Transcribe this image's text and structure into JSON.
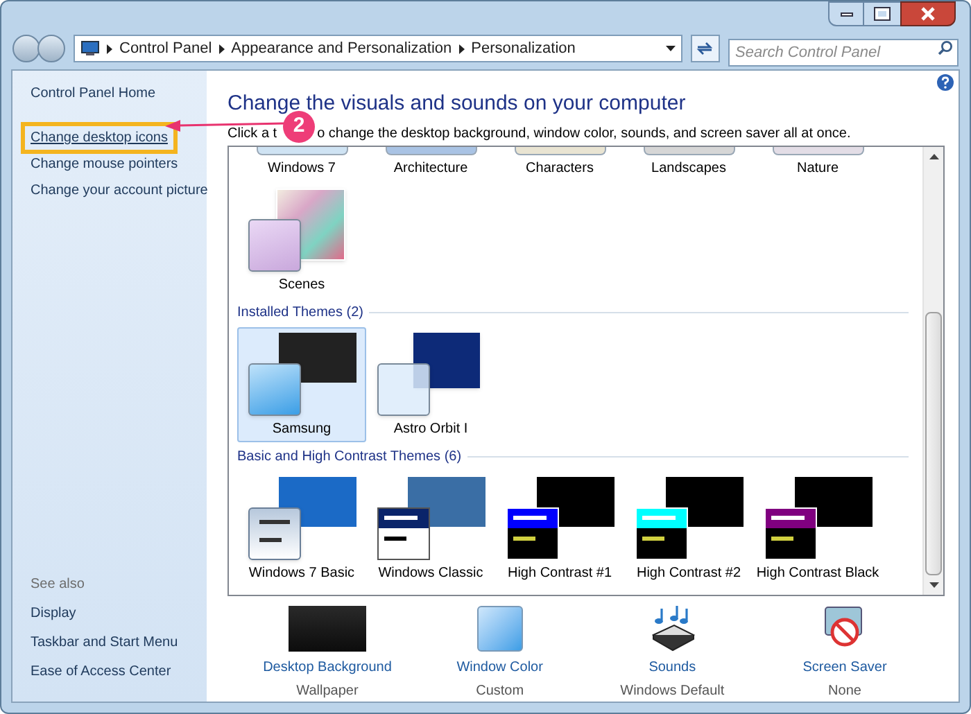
{
  "address_bar": {
    "breadcrumbs": [
      "Control Panel",
      "Appearance and Personalization",
      "Personalization"
    ]
  },
  "search": {
    "placeholder": "Search Control Panel"
  },
  "sidebar": {
    "home": "Control Panel Home",
    "tasks": [
      {
        "label": "Change desktop icons",
        "highlighted": true
      },
      {
        "label": "Change mouse pointers",
        "highlighted": false
      },
      {
        "label": "Change your account picture",
        "highlighted": false
      }
    ],
    "see_also_title": "See also",
    "see_also": [
      "Display",
      "Taskbar and Start Menu",
      "Ease of Access Center"
    ]
  },
  "annotation": {
    "label": "2"
  },
  "heading": "Change the visuals and sounds on your computer",
  "instruction_parts": [
    "Click a t",
    "o change the desktop background, window color, sounds, and screen saver all at once."
  ],
  "theme_sections": [
    {
      "items": [
        {
          "label": "Windows 7",
          "kind": "cut",
          "selected": false,
          "color": "#cfe3f3"
        },
        {
          "label": "Architecture",
          "kind": "cut",
          "selected": false,
          "color": "#a9c3e4"
        },
        {
          "label": "Characters",
          "kind": "cut",
          "selected": false,
          "color": "#e9e4d2"
        },
        {
          "label": "Landscapes",
          "kind": "cut",
          "selected": false,
          "color": "#d6d6d6"
        },
        {
          "label": "Nature",
          "kind": "cut",
          "selected": false,
          "color": "#e3dde6"
        },
        {
          "label": "Scenes",
          "kind": "scenes",
          "selected": false,
          "color": "#c9a8dc"
        }
      ]
    },
    {
      "title": "Installed Themes (2)",
      "items": [
        {
          "label": "Samsung",
          "kind": "samsung",
          "selected": true,
          "color": "#222222"
        },
        {
          "label": "Astro Orbit I",
          "kind": "astro",
          "selected": false,
          "color": "#0d2a78"
        }
      ]
    },
    {
      "title": "Basic and High Contrast Themes (6)",
      "items": [
        {
          "label": "Windows 7 Basic",
          "kind": "basic",
          "selected": false,
          "color": "#1b6ac6"
        },
        {
          "label": "Windows Classic",
          "kind": "classic",
          "selected": false,
          "color": "#3a6ea5"
        },
        {
          "label": "High Contrast #1",
          "kind": "hc",
          "selected": false,
          "color": "#0000ff"
        },
        {
          "label": "High Contrast #2",
          "kind": "hc",
          "selected": false,
          "color": "#00ffff"
        },
        {
          "label": "High Contrast Black",
          "kind": "hc",
          "selected": false,
          "color": "#800080"
        }
      ]
    }
  ],
  "settings": [
    {
      "label": "Desktop Background",
      "value": "Wallpaper",
      "kind": "wallpaper"
    },
    {
      "label": "Window Color",
      "value": "Custom",
      "kind": "color"
    },
    {
      "label": "Sounds",
      "value": "Windows Default",
      "kind": "sounds"
    },
    {
      "label": "Screen Saver",
      "value": "None",
      "kind": "screensaver"
    }
  ]
}
